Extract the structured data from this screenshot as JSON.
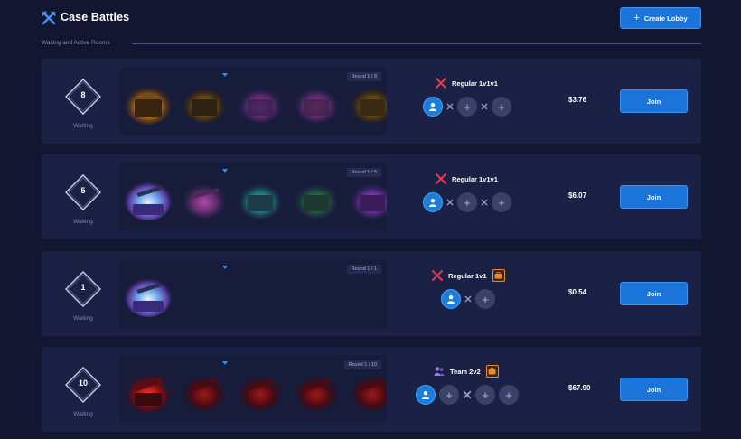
{
  "header": {
    "title": "Case Battles",
    "create_button_label": "Create Lobby",
    "section_label": "Waiting and Active Rooms"
  },
  "colors": {
    "background": "#121631",
    "card": "#1b2145",
    "accent_blue": "#1b74d9",
    "crossed_swords_red": "#e23a4e",
    "team_purple": "#9b7be0",
    "badge_orange": "#f08a24"
  },
  "rooms": [
    {
      "cases_count": "8",
      "status": "Waiting",
      "round": "Round 1 / 8",
      "mode": "Regular 1v1v1",
      "mode_icon": "crossed-swords-icon",
      "price": "$3.76",
      "join_label": "Join",
      "case_theme": "gold-fire"
    },
    {
      "cases_count": "5",
      "status": "Waiting",
      "round": "Round 1 / 5",
      "mode": "Regular 1v1v1",
      "mode_icon": "crossed-swords-icon",
      "price": "$6.07",
      "join_label": "Join",
      "case_theme": "anime-mixed"
    },
    {
      "cases_count": "1",
      "status": "Waiting",
      "round": "Round 1 / 1",
      "mode": "Regular 1v1",
      "mode_icon": "crossed-swords-icon",
      "price": "$0.54",
      "join_label": "Join",
      "case_theme": "anime",
      "extra_badge": "case-badge-icon"
    },
    {
      "cases_count": "10",
      "status": "Waiting",
      "round": "Round 1 / 10",
      "mode": "Team 2v2",
      "mode_icon": "team-icon",
      "price": "$67.90",
      "join_label": "Join",
      "case_theme": "red-fire",
      "extra_badge": "case-badge-icon"
    }
  ]
}
